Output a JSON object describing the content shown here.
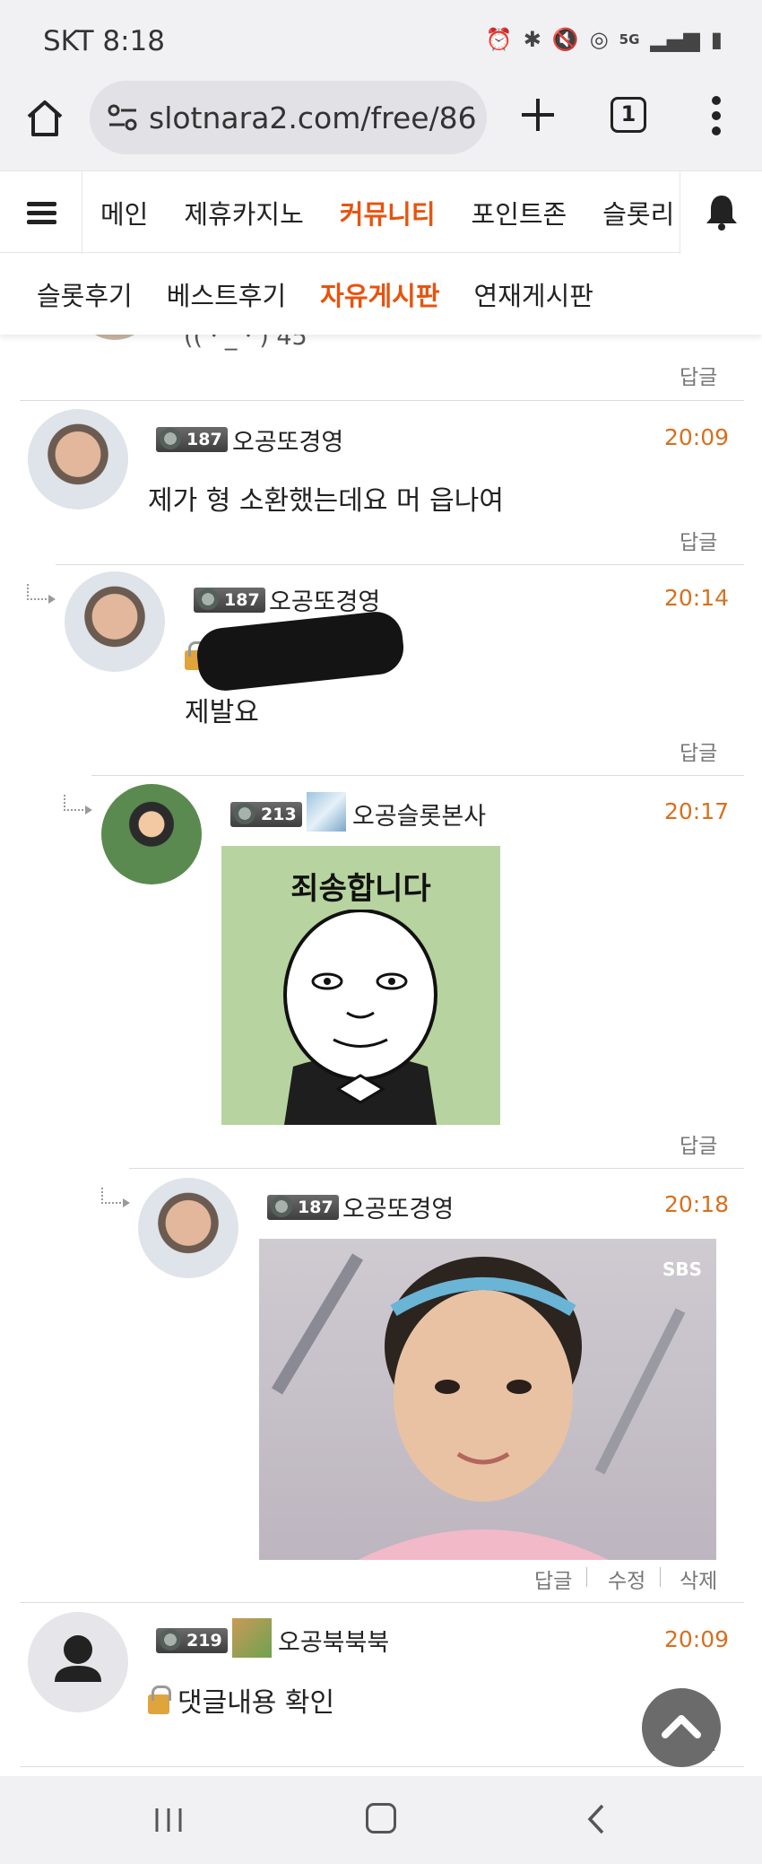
{
  "status_bar": {
    "carrier_time": "SKT 8:18",
    "icons": [
      "alarm-icon",
      "bluetooth-icon",
      "mute-icon",
      "hotspot-icon",
      "5g-icon",
      "signal-icon",
      "battery-icon"
    ],
    "network_label": "5G"
  },
  "browser": {
    "url": "slotnara2.com/free/86",
    "tab_count": "1"
  },
  "site_nav": {
    "items": [
      "메인",
      "제휴카지노",
      "커뮤니티",
      "포인트존",
      "슬롯리"
    ],
    "active_index": 2,
    "active_color": "#e8530e"
  },
  "sub_nav": {
    "items": [
      "슬롯후기",
      "베스트후기",
      "자유게시판",
      "연재게시판"
    ],
    "active_index": 2
  },
  "partial_top": {
    "text": "((ㆍ_ㆍ) 45",
    "reply": "답글"
  },
  "comments": [
    {
      "level": "187",
      "username": "오공또경영",
      "time": "20:09",
      "text": "제가 형 소환했는데요 머 읍나여",
      "reply": "답글"
    },
    {
      "level": "187",
      "username": "오공또경영",
      "time": "20:14",
      "text": "제발요",
      "reply": "답글"
    },
    {
      "level": "213",
      "username": "오공슬롯본사",
      "time": "20:17",
      "sticker_text": "죄송합니다",
      "reply": "답글"
    },
    {
      "level": "187",
      "username": "오공또경영",
      "time": "20:18",
      "watermark": "SBS",
      "actions": [
        "답글",
        "수정",
        "삭제"
      ]
    },
    {
      "level": "219",
      "username": "오공북북북",
      "time": "20:09",
      "text": "댓글내용 확인",
      "reply": "답글"
    }
  ]
}
